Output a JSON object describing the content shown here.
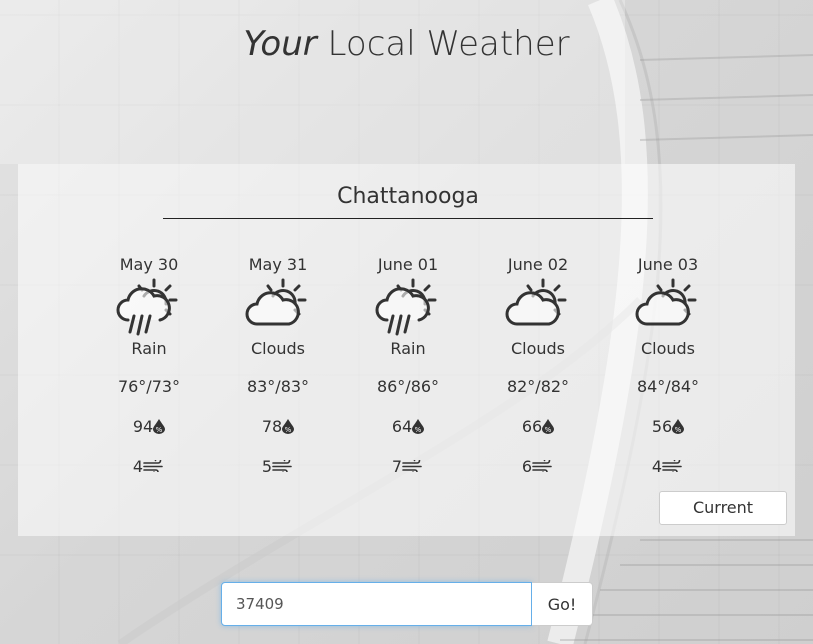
{
  "header": {
    "title_em": "Your",
    "title_rest": " Local Weather"
  },
  "city": "Chattanooga",
  "forecast": [
    {
      "date": "May 30",
      "icon": "rain-sun-icon",
      "condition": "Rain",
      "temp": "76°/73°",
      "humidity": "94",
      "wind": "4"
    },
    {
      "date": "May 31",
      "icon": "cloud-sun-icon",
      "condition": "Clouds",
      "temp": "83°/83°",
      "humidity": "78",
      "wind": "5"
    },
    {
      "date": "June 01",
      "icon": "rain-sun-icon",
      "condition": "Rain",
      "temp": "86°/86°",
      "humidity": "64",
      "wind": "7"
    },
    {
      "date": "June 02",
      "icon": "cloud-sun-icon",
      "condition": "Clouds",
      "temp": "82°/82°",
      "humidity": "66",
      "wind": "6"
    },
    {
      "date": "June 03",
      "icon": "cloud-sun-icon",
      "condition": "Clouds",
      "temp": "84°/84°",
      "humidity": "56",
      "wind": "4"
    }
  ],
  "current_button": "Current",
  "search": {
    "value": "37409",
    "go_label": "Go!"
  },
  "colors": {
    "text": "#333333",
    "focus": "#66afe9"
  }
}
